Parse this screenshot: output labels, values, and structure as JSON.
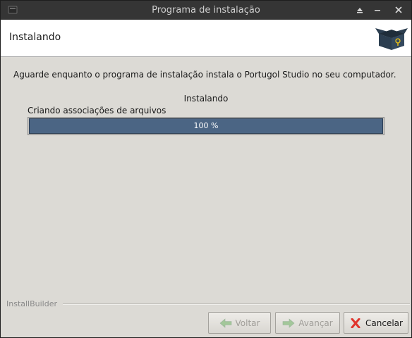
{
  "window": {
    "title": "Programa de instalação"
  },
  "header": {
    "heading": "Instalando"
  },
  "content": {
    "description": "Aguarde enquanto o programa de instalação instala o  Portugol Studio no seu computador.",
    "status_label": "Instalando",
    "task_label": "Criando associações de arquivos",
    "progress_percent": 100,
    "progress_text": "100 %"
  },
  "footer": {
    "brand": "InstallBuilder",
    "back_label": "Voltar",
    "next_label": "Avançar",
    "cancel_label": "Cancelar"
  },
  "colors": {
    "progress_fill": "#4b6584",
    "titlebar_bg": "#353535",
    "window_bg": "#dcdad5",
    "cancel_icon": "#e0342c"
  },
  "icons": [
    "app-icon",
    "maximize-icon",
    "minimize-icon",
    "close-icon",
    "box-icon",
    "back-arrow-icon",
    "next-arrow-icon",
    "cancel-x-icon"
  ]
}
